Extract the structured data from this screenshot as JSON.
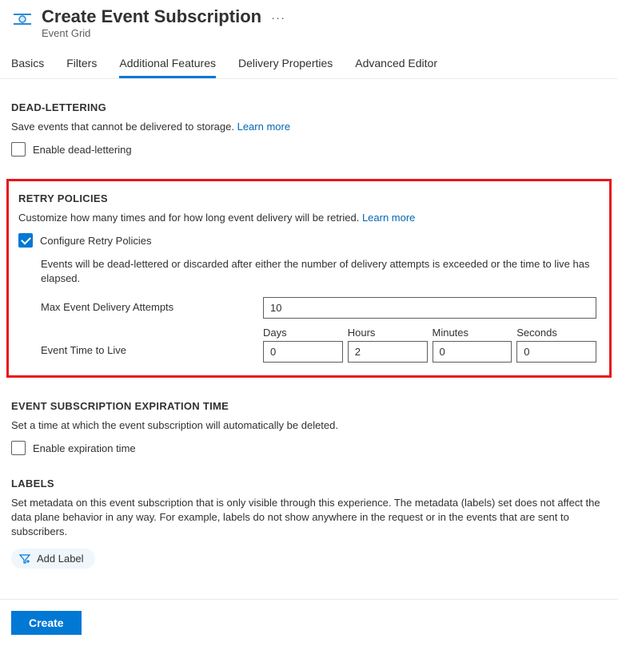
{
  "header": {
    "title": "Create Event Subscription",
    "subtitle": "Event Grid"
  },
  "tabs": [
    {
      "label": "Basics"
    },
    {
      "label": "Filters"
    },
    {
      "label": "Additional Features"
    },
    {
      "label": "Delivery Properties"
    },
    {
      "label": "Advanced Editor"
    }
  ],
  "dead_lettering": {
    "header": "DEAD-LETTERING",
    "desc": "Save events that cannot be delivered to storage.",
    "learn_more": "Learn more",
    "checkbox_label": "Enable dead-lettering"
  },
  "retry": {
    "header": "RETRY POLICIES",
    "desc": "Customize how many times and for how long event delivery will be retried.",
    "learn_more": "Learn more",
    "checkbox_label": "Configure Retry Policies",
    "note": "Events will be dead-lettered or discarded after either the number of delivery attempts is exceeded or the time to live has elapsed.",
    "max_attempts_label": "Max Event Delivery Attempts",
    "max_attempts_value": "10",
    "ttl_label": "Event Time to Live",
    "ttl": {
      "days_label": "Days",
      "days_value": "0",
      "hours_label": "Hours",
      "hours_value": "2",
      "minutes_label": "Minutes",
      "minutes_value": "0",
      "seconds_label": "Seconds",
      "seconds_value": "0"
    }
  },
  "expiration": {
    "header": "EVENT SUBSCRIPTION EXPIRATION TIME",
    "desc": "Set a time at which the event subscription will automatically be deleted.",
    "checkbox_label": "Enable expiration time"
  },
  "labels": {
    "header": "LABELS",
    "desc": "Set metadata on this event subscription that is only visible through this experience. The metadata (labels) set does not affect the data plane behavior in any way. For example, labels do not show anywhere in the request or in the events that are sent to subscribers.",
    "add_label": "Add Label"
  },
  "footer": {
    "create_label": "Create"
  }
}
